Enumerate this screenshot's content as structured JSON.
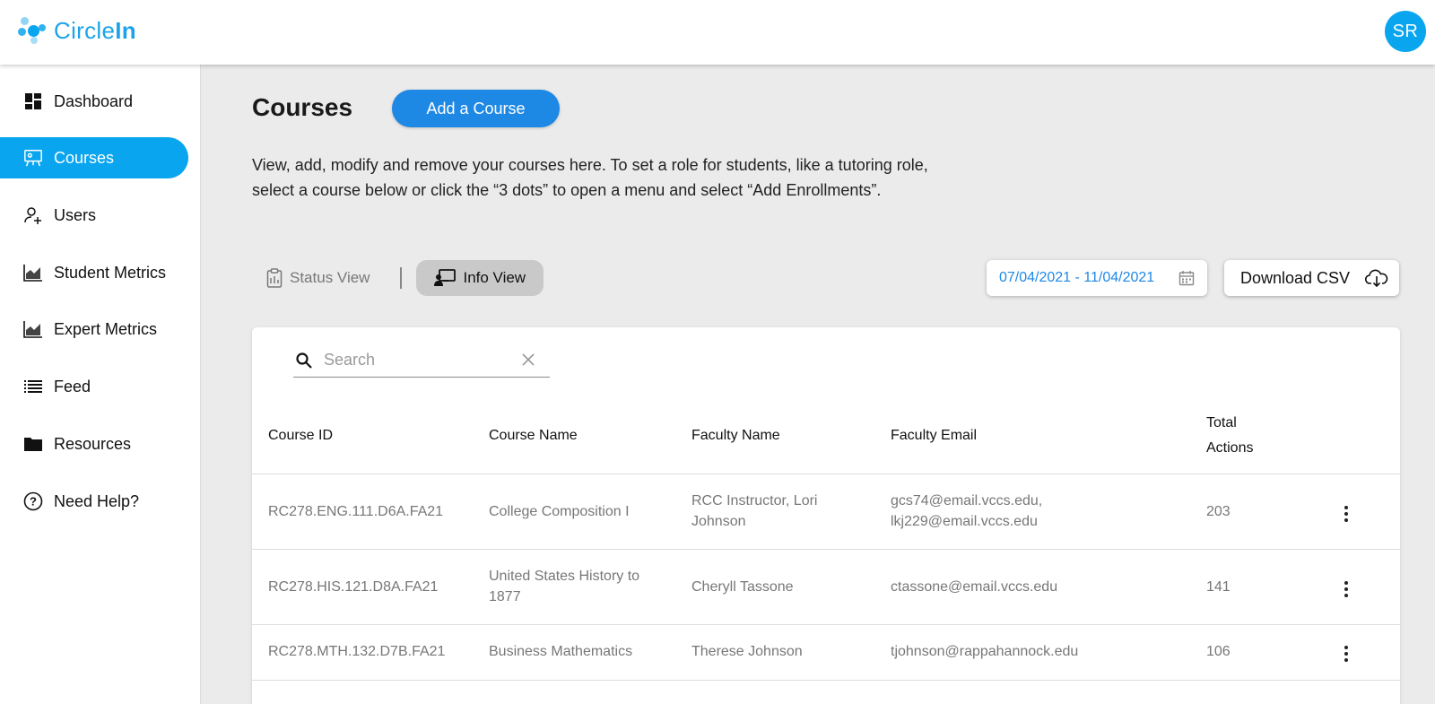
{
  "app": {
    "logo_prefix": "Circle",
    "logo_suffix": "In",
    "user_initials": "SR",
    "accent_color": "#0aa5ef"
  },
  "sidebar": {
    "items": [
      {
        "label": "Dashboard",
        "icon": "dashboard-icon"
      },
      {
        "label": "Courses",
        "icon": "presentation-icon",
        "active": true
      },
      {
        "label": "Users",
        "icon": "user-add-icon"
      },
      {
        "label": "Student Metrics",
        "icon": "chart-icon"
      },
      {
        "label": "Expert Metrics",
        "icon": "chart-icon"
      },
      {
        "label": "Feed",
        "icon": "list-icon"
      },
      {
        "label": "Resources",
        "icon": "folder-icon"
      },
      {
        "label": "Need Help?",
        "icon": "help-icon"
      }
    ]
  },
  "page": {
    "title": "Courses",
    "add_button": "Add a Course",
    "description": "View, add, modify and remove your courses here. To set a role for students, like a tutoring role, select a course below or click the “3 dots” to open a menu and select “Add Enrollments”."
  },
  "views": {
    "status": "Status View",
    "info": "Info View",
    "selected": "Info View"
  },
  "date_range": "07/04/2021 - 11/04/2021",
  "download_csv": "Download CSV",
  "search": {
    "placeholder": "Search",
    "value": ""
  },
  "table": {
    "headers": {
      "course_id": "Course ID",
      "course_name": "Course Name",
      "faculty_name": "Faculty Name",
      "faculty_email": "Faculty Email",
      "total_actions_1": "Total",
      "total_actions_2": "Actions"
    },
    "rows": [
      {
        "course_id": "RC278.ENG.111.D6A.FA21",
        "course_name": "College Composition I",
        "faculty_name": "RCC Instructor, Lori Johnson",
        "faculty_email": "gcs74@email.vccs.edu, lkj229@email.vccs.edu",
        "total_actions": "203"
      },
      {
        "course_id": "RC278.HIS.121.D8A.FA21",
        "course_name": "United States History to 1877",
        "faculty_name": "Cheryll Tassone",
        "faculty_email": "ctassone@email.vccs.edu",
        "total_actions": "141"
      },
      {
        "course_id": "RC278.MTH.132.D7B.FA21",
        "course_name": "Business Mathematics",
        "faculty_name": "Therese Johnson",
        "faculty_email": "tjohnson@rappahannock.edu",
        "total_actions": "106"
      }
    ]
  }
}
